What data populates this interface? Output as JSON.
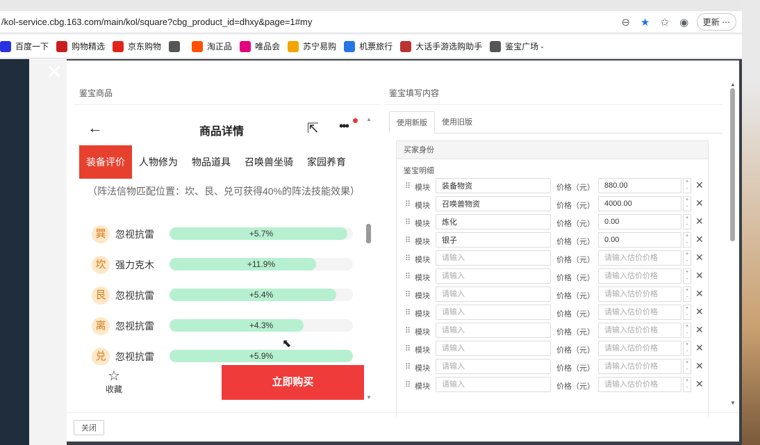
{
  "browser": {
    "url": "/kol-service.cbg.163.com/main/kol/square?cbg_product_id=dhxy&page=1#my",
    "more_label": "更新 ⋯",
    "bookmarks": [
      {
        "label": "百度一下",
        "icon": "paw-icon",
        "color": "#2932e1"
      },
      {
        "label": "购物精选",
        "icon": "T-icon",
        "color": "#c71f1f"
      },
      {
        "label": "京东购物",
        "icon": "JD-icon",
        "color": "#e2231a"
      },
      {
        "label": "",
        "icon": "globe-icon",
        "color": "#555555"
      },
      {
        "label": "淘正品",
        "icon": "taobao-icon",
        "color": "#ff5000"
      },
      {
        "label": "唯品会",
        "icon": "vip-icon",
        "color": "#e4007f"
      },
      {
        "label": "苏宁易购",
        "icon": "suning-icon",
        "color": "#f3a600"
      },
      {
        "label": "机票旅行",
        "icon": "ctrip-icon",
        "color": "#2577e3"
      },
      {
        "label": "大话手游选购助手",
        "icon": "game-icon",
        "color": "#b33"
      },
      {
        "label": "鉴宝广场 -",
        "icon": "globe-icon",
        "color": "#555555"
      }
    ]
  },
  "modal": {
    "left_title": "鉴宝商品",
    "right_title": "鉴宝填写内容",
    "close_label": "关闭"
  },
  "phone": {
    "title": "商品详情",
    "tabs": [
      "装备评价",
      "人物修为",
      "物品道具",
      "召唤兽坐骑",
      "家园养育"
    ],
    "note": "（阵法信物匹配位置：坎、艮、兑可获得40%的阵法技能效果）",
    "attributes": [
      {
        "char": "巽",
        "name": "忽视抗雷",
        "label": "+5.7%",
        "fill": 0.97
      },
      {
        "char": "坎",
        "name": "强力克木",
        "label": "+11.9%",
        "fill": 0.8
      },
      {
        "char": "艮",
        "name": "忽视抗雷",
        "label": "+5.4%",
        "fill": 0.91
      },
      {
        "char": "离",
        "name": "忽视抗雷",
        "label": "+4.3%",
        "fill": 0.73
      },
      {
        "char": "兑",
        "name": "忽视抗雷",
        "label": "+5.9%",
        "fill": 1.0
      }
    ],
    "fav_label": "收藏",
    "buy_label": "立即购买"
  },
  "form": {
    "tabs": [
      "使用新版",
      "使用旧版"
    ],
    "section_title": "买家身份",
    "sub_title": "鉴宝明细",
    "module_label": "模块",
    "price_label": "价格（元）",
    "module_placeholder": "请输入",
    "price_placeholder": "请输入估价价格",
    "rows": [
      {
        "module": "装备物资",
        "price": "880.00"
      },
      {
        "module": "召唤兽物资",
        "price": "4000.00"
      },
      {
        "module": "炼化",
        "price": "0.00"
      },
      {
        "module": "银子",
        "price": "0.00"
      },
      {
        "module": "",
        "price": ""
      },
      {
        "module": "",
        "price": ""
      },
      {
        "module": "",
        "price": ""
      },
      {
        "module": "",
        "price": ""
      },
      {
        "module": "",
        "price": ""
      },
      {
        "module": "",
        "price": ""
      },
      {
        "module": "",
        "price": ""
      },
      {
        "module": "",
        "price": ""
      }
    ]
  }
}
